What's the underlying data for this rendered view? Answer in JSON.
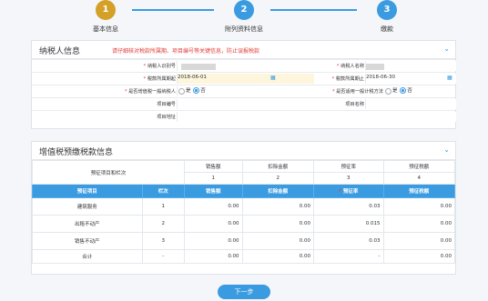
{
  "steps": [
    {
      "num": "1",
      "label": "基本信息"
    },
    {
      "num": "2",
      "label": "附列资料信息"
    },
    {
      "num": "3",
      "label": "缴款"
    }
  ],
  "taxpayer": {
    "title": "纳税人信息",
    "warning": "请仔细核对税款所属期、项目编号等关键信息，防止误报税款",
    "id_label": "纳税人识别号",
    "name_label": "纳税人名称",
    "period_start_label": "税款所属期起",
    "period_start": "2018-06-01",
    "period_end_label": "税款所属期止",
    "period_end": "2018-06-30",
    "general_label": "是否增值税一般纳税人",
    "simple_label": "是否适用一般计税方法",
    "yes": "是",
    "no": "否",
    "project_no_label": "项目编号",
    "project_name_label": "项目名称",
    "project_addr_label": "项目地址"
  },
  "prepay": {
    "title": "增值税预缴税款信息",
    "top_headers": [
      "预征项目和栏次",
      "销售额",
      "扣除金额",
      "预征率",
      "预征税额"
    ],
    "col_nums": [
      "1",
      "2",
      "3",
      "4"
    ],
    "headers": [
      "预征项目",
      "栏次",
      "销售额",
      "扣除金额",
      "预征率",
      "预征税额"
    ],
    "rows": [
      {
        "item": "建筑服务",
        "col": "1",
        "sales": "0.00",
        "deduct": "0.00",
        "rate": "0.03",
        "tax": "0.00"
      },
      {
        "item": "出租不动产",
        "col": "2",
        "sales": "0.00",
        "deduct": "0.00",
        "rate": "0.015",
        "tax": "0.00"
      },
      {
        "item": "销售不动产",
        "col": "3",
        "sales": "0.00",
        "deduct": "0.00",
        "rate": "0.03",
        "tax": "0.00"
      },
      {
        "item": "合计",
        "col": "-",
        "sales": "0.00",
        "deduct": "0.00",
        "rate": "-",
        "tax": "0.00"
      }
    ]
  },
  "next_label": "下一步",
  "colors": {
    "accent": "#3a9be0",
    "step1": "#d4a027",
    "warning": "#e0403c",
    "date_field": "#fdf6dc"
  }
}
